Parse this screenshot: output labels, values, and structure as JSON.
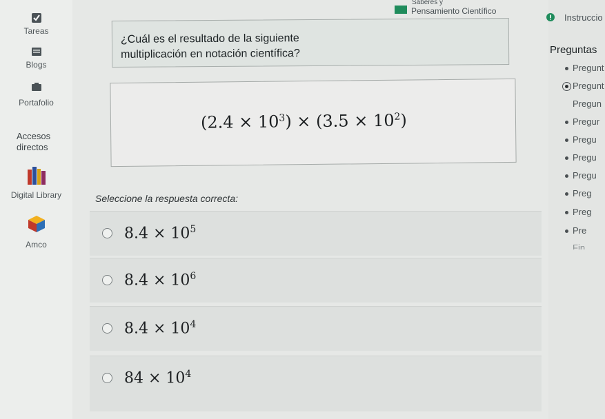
{
  "sidebar": {
    "items": [
      {
        "label": "Tareas",
        "icon": "checkbox-icon"
      },
      {
        "label": "Blogs",
        "icon": "blog-icon"
      },
      {
        "label": "Portafolio",
        "icon": "portfolio-icon"
      },
      {
        "label": "Accesos directos",
        "icon": ""
      },
      {
        "label": "Digital Library",
        "icon": "books-icon"
      },
      {
        "label": "Amco",
        "icon": "cube-icon"
      }
    ]
  },
  "header": {
    "course_title_top": "Saberes y",
    "course_title": "Pensamiento Científico",
    "instructions_label": "Instruccio",
    "accent_color": "#1f8c5c",
    "alert_color": "#1f8c5c"
  },
  "question": {
    "text_line1": "¿Cuál es el resultado de la siguiente",
    "text_line2": "multiplicación en notación científica?",
    "expression": {
      "a_mantissa": "2.4",
      "a_exponent": "3",
      "b_mantissa": "3.5",
      "b_exponent": "2"
    },
    "instruction": "Seleccione la respuesta correcta:",
    "options": [
      {
        "mantissa": "8.4",
        "base": "10",
        "exponent": "5"
      },
      {
        "mantissa": "8.4",
        "base": "10",
        "exponent": "6"
      },
      {
        "mantissa": "8.4",
        "base": "10",
        "exponent": "4"
      },
      {
        "mantissa": "84",
        "base": "10",
        "exponent": "4"
      }
    ]
  },
  "question_nav": {
    "title": "Preguntas",
    "items": [
      {
        "label": "Pregunt",
        "current": false
      },
      {
        "label": "Pregunt",
        "current": true
      },
      {
        "label": "Pregun",
        "current": false
      },
      {
        "label": "Pregur",
        "current": false
      },
      {
        "label": "Pregu",
        "current": false
      },
      {
        "label": "Pregu",
        "current": false
      },
      {
        "label": "Pregu",
        "current": false
      },
      {
        "label": "Preg",
        "current": false
      },
      {
        "label": "Preg",
        "current": false
      },
      {
        "label": "Pre",
        "current": false
      },
      {
        "label": "Fin",
        "current": false
      }
    ]
  }
}
